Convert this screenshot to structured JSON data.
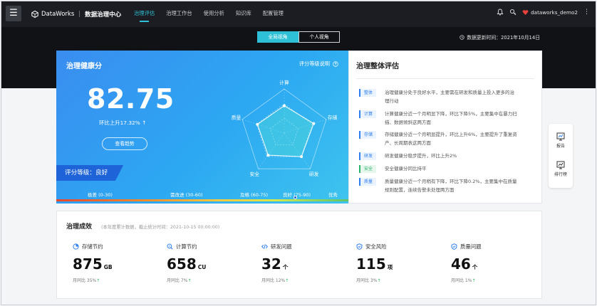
{
  "header": {
    "product": "DataWorks",
    "module": "数据治理中心",
    "tabs": [
      {
        "label": "治理评估",
        "active": true
      },
      {
        "label": "治理工作台",
        "active": false
      },
      {
        "label": "使用分析",
        "active": false
      },
      {
        "label": "知识库",
        "active": false
      },
      {
        "label": "配置管理",
        "active": false
      }
    ],
    "user": "dataworks_demo2"
  },
  "view_toggle": {
    "global": "全局视角",
    "personal": "个人视角",
    "selected": "global"
  },
  "update_time": "数据更新时间：2021年10月14日",
  "health": {
    "title": "治理健康分",
    "grade_info": "评分等级说明",
    "score": "82.75",
    "mom": "环比上升17.32%",
    "trend_button": "查看趋势",
    "grade": "评分等级：良好",
    "radar_axes": [
      "计算",
      "存储",
      "研发",
      "安全",
      "质量"
    ],
    "radar_values": [
      0.62,
      0.7,
      0.66,
      0.62,
      0.64
    ],
    "scale": [
      "极差 (0-30)",
      "需改进 (30-60)",
      "及格 (60-75)",
      "良好 (75-90)",
      "优秀"
    ],
    "scale_pos": 0.82
  },
  "assessment": {
    "title": "治理整体评估",
    "rows": [
      {
        "tag": "整体",
        "color": "blue",
        "text": [
          "治理健康分处于良好水平，主要需在研发和质量上投入更多的治",
          "理行动"
        ]
      },
      {
        "tag": "计算",
        "color": "blue",
        "text": [
          "计算健康分近一个月明显下降，环比下降5%，主要集中在暴力扫",
          "描、数据倾斜这两方面"
        ]
      },
      {
        "tag": "存储",
        "color": "blue",
        "text": [
          "存储健康分近一个月明显提升，环比上升6%，主要提升了重复资",
          "产、长周期表这两方面"
        ]
      },
      {
        "tag": "研发",
        "color": "blue",
        "text": [
          "研发健康分稳步提升，环比上升2%"
        ]
      },
      {
        "tag": "安全",
        "color": "green",
        "text": [
          "安全健康分同比持平"
        ]
      },
      {
        "tag": "质量",
        "color": "blue",
        "text": [
          "质量健康分近一个月稍有下降，环比下降0.2%，主要集中在质量",
          "规则配置，连续告警未处理两方面"
        ]
      }
    ]
  },
  "side_panel": [
    {
      "label": "报告",
      "icon": "report-icon"
    },
    {
      "label": "排行榜",
      "icon": "ranking-icon"
    }
  ],
  "results": {
    "title": "治理成效",
    "subtitle": "(本年度累计数据，截止统计时间：2021-10-15 00:00:00)",
    "metrics": [
      {
        "label": "存储节约",
        "value": "875",
        "unit": "GB",
        "mom": "月同比 35%",
        "icon": "storage-icon"
      },
      {
        "label": "计算节约",
        "value": "658",
        "unit": "CU",
        "mom": "月同比 7%",
        "icon": "compute-icon"
      },
      {
        "label": "研发问题",
        "value": "32",
        "unit": "个",
        "mom": "月同比 12%",
        "icon": "dev-icon"
      },
      {
        "label": "安全风险",
        "value": "115",
        "unit": "项",
        "mom": "月同比 3%",
        "icon": "security-icon"
      },
      {
        "label": "质量问题",
        "value": "46",
        "unit": "个",
        "mom": "月同比 1%",
        "icon": "quality-icon"
      }
    ]
  },
  "colors": {
    "accent": "#2ec0d6",
    "topbar": "#1b1d22",
    "blue": "#2f7ff0",
    "green": "#27b36a"
  }
}
